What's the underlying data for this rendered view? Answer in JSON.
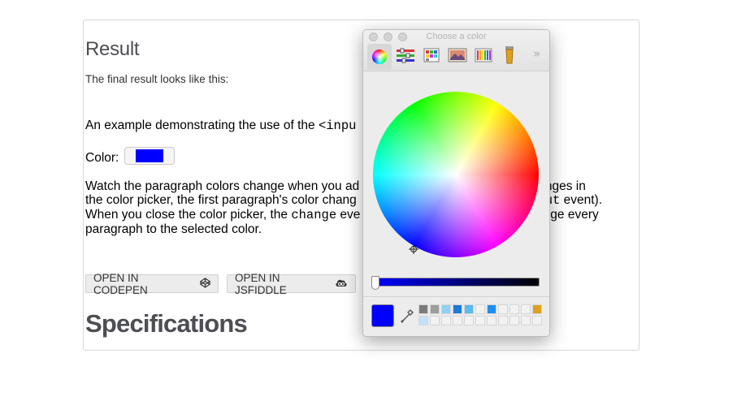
{
  "page": {
    "result_heading": "Result",
    "result_description": "The final result looks like this:",
    "example_prefix": "An example demonstrating the use of the ",
    "example_code": "<inpu",
    "color_label": "Color:",
    "paragraph": {
      "l1a": "Watch the paragraph colors change when you ad",
      "l1b": "ke changes in",
      "l2a": "the color picker, the first paragraph's color chang",
      "l2b_code": "input",
      "l2c": " event).",
      "l3a": "When you close the color picker, the ",
      "l3b_code": "change",
      "l3c": " eve",
      "l3d": "hange every",
      "l4": "paragraph to the selected color."
    },
    "buttons": {
      "codepen": "OPEN IN CODEPEN",
      "jsfiddle": "OPEN IN JSFIDDLE"
    },
    "specifications_heading": "Specifications"
  },
  "picker": {
    "title": "Choose a color",
    "more": "»",
    "modes": [
      "color-wheel-icon",
      "color-sliders-icon",
      "color-palettes-icon",
      "image-palettes-icon",
      "pencils-icon",
      "paint-brush-icon"
    ],
    "selected_mode": "color-wheel-icon",
    "current_color": "#0000ff",
    "brightness": 1.0,
    "swatches_row1": [
      "#7b7b7b",
      "#9d9d9d",
      "#8fd1f7",
      "#1f7ad6",
      "#5cb9f2",
      "#f2f2f2",
      "#1a8ff0",
      "#f2f2f2",
      "#f2f2f2",
      "#f2f2f2",
      "#e0a01c"
    ],
    "swatches_row2": [
      "#c2e2fb",
      "#f2f2f2",
      "#f2f2f2",
      "#f2f2f2",
      "#f2f2f2",
      "#f2f2f2",
      "#f2f2f2",
      "#f2f2f2",
      "#f2f2f2",
      "#f2f2f2",
      "#f2f2f2"
    ]
  }
}
